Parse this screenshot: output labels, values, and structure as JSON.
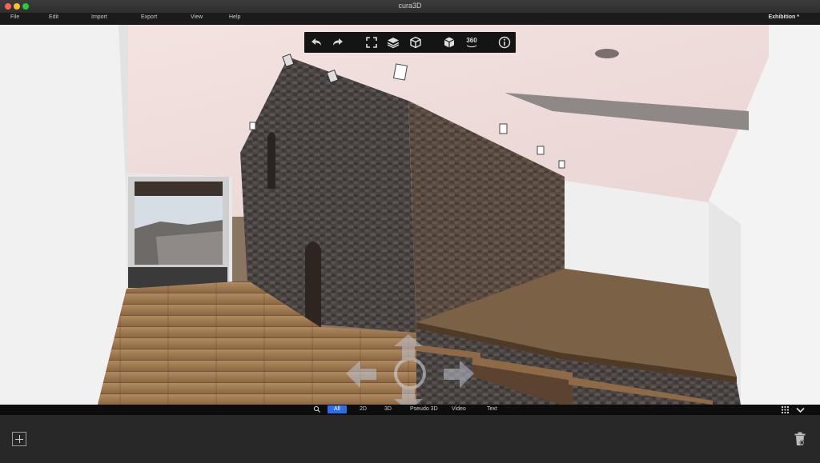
{
  "window": {
    "title": "cura3D"
  },
  "menubar": {
    "items": [
      "File",
      "Edit",
      "Import",
      "Export",
      "View",
      "Help"
    ],
    "exhibition_label": "Exhibition *"
  },
  "toolbar": {
    "icons": [
      "undo-icon",
      "redo-icon",
      "fit-view-icon",
      "layers-icon",
      "cube-view-icon",
      "package-icon",
      "rotate-360-icon",
      "info-icon"
    ],
    "rotate_label": "360"
  },
  "view_modes": {
    "items": [
      "All",
      "2D",
      "3D",
      "Pseudo 3D",
      "Video",
      "Text"
    ],
    "active": "All"
  },
  "colors": {
    "active_mode": "#2a6ef0",
    "toolbar_bg": "#141414",
    "panel_bg": "#282828"
  }
}
